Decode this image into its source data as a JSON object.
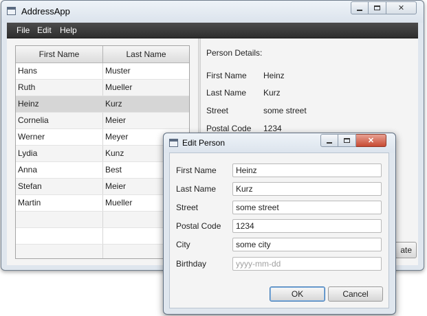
{
  "main_window": {
    "title": "AddressApp",
    "menu": [
      "File",
      "Edit",
      "Help"
    ]
  },
  "table": {
    "columns": [
      "First Name",
      "Last Name"
    ],
    "rows": [
      {
        "first": "Hans",
        "last": "Muster"
      },
      {
        "first": "Ruth",
        "last": "Mueller"
      },
      {
        "first": "Heinz",
        "last": "Kurz"
      },
      {
        "first": "Cornelia",
        "last": "Meier"
      },
      {
        "first": "Werner",
        "last": "Meyer"
      },
      {
        "first": "Lydia",
        "last": "Kunz"
      },
      {
        "first": "Anna",
        "last": "Best"
      },
      {
        "first": "Stefan",
        "last": "Meier"
      },
      {
        "first": "Martin",
        "last": "Mueller"
      }
    ],
    "selected_row": 2
  },
  "details": {
    "heading": "Person Details:",
    "fields": [
      {
        "label": "First Name",
        "value": "Heinz"
      },
      {
        "label": "Last Name",
        "value": "Kurz"
      },
      {
        "label": "Street",
        "value": "some street"
      },
      {
        "label": "Postal Code",
        "value": "1234"
      }
    ],
    "partial_button_text": "ate"
  },
  "dialog": {
    "title": "Edit Person",
    "fields": [
      {
        "label": "First Name",
        "value": "Heinz",
        "placeholder": ""
      },
      {
        "label": "Last Name",
        "value": "Kurz",
        "placeholder": ""
      },
      {
        "label": "Street",
        "value": "some street",
        "placeholder": ""
      },
      {
        "label": "Postal Code",
        "value": "1234",
        "placeholder": ""
      },
      {
        "label": "City",
        "value": "some city",
        "placeholder": ""
      },
      {
        "label": "Birthday",
        "value": "",
        "placeholder": "yyyy-mm-dd"
      }
    ],
    "ok_label": "OK",
    "cancel_label": "Cancel"
  },
  "icons": {
    "app": "app-window-icon",
    "minimize": "minimize-icon",
    "maximize": "maximize-icon",
    "close": "close-icon"
  },
  "colors": {
    "menubar": "#3a3a3a",
    "selected_row": "#d6d6d6",
    "close_button": "#c74a33",
    "default_button_border": "#3c78b5"
  }
}
